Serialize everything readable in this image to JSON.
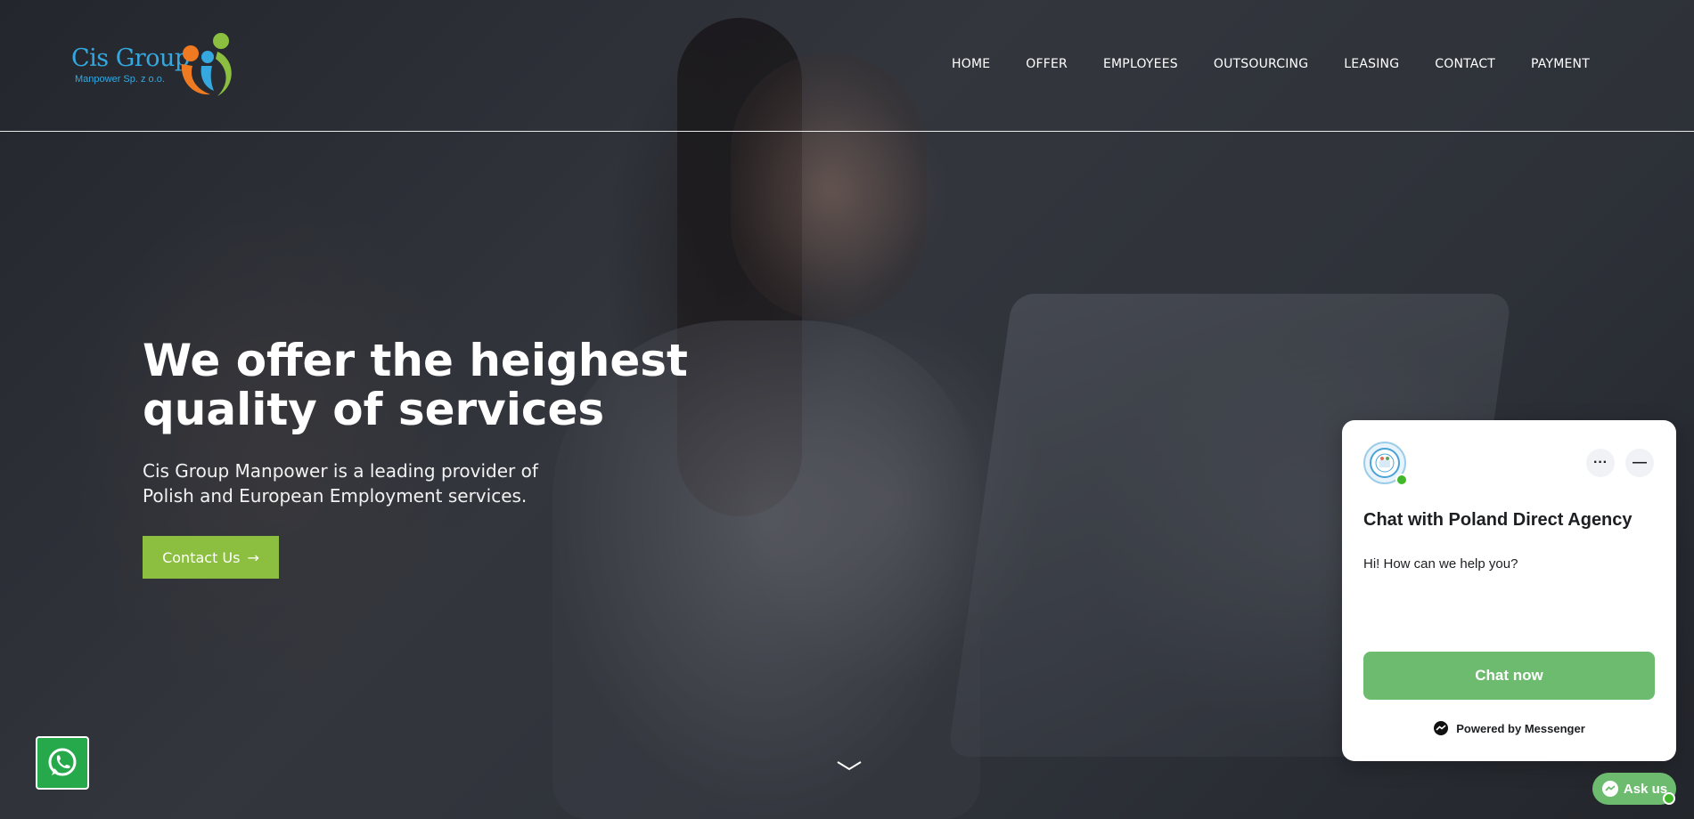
{
  "logo": {
    "name": "Cis Group",
    "subtitle": "Manpower Sp. z o.o."
  },
  "nav": {
    "items": [
      "HOME",
      "OFFER",
      "EMPLOYEES",
      "OUTSOURCING",
      "LEASING",
      "CONTACT",
      "PAYMENT"
    ]
  },
  "hero": {
    "title_line1": "We offer the heighest",
    "title_line2": "quality of services",
    "subtitle_line1": "Cis Group Manpower is a leading provider of",
    "subtitle_line2": "Polish and European Employment services.",
    "cta_label": "Contact Us",
    "cta_arrow": "→"
  },
  "chat_widget": {
    "title": "Chat with Poland Direct Agency",
    "greeting": "Hi! How can we help you?",
    "button_label": "Chat now",
    "powered_by": "Powered by Messenger",
    "ask_label": "Ask us"
  },
  "icons": {
    "whatsapp": "whatsapp-icon",
    "messenger": "messenger-icon",
    "more": "more-options-icon",
    "minimize": "minimize-icon",
    "scroll": "chevron-down-icon"
  },
  "colors": {
    "accent_green": "#8cbf3f",
    "chat_green": "#6cbb6e",
    "logo_blue": "#35a8e0",
    "whatsapp_green": "#25a94a"
  }
}
